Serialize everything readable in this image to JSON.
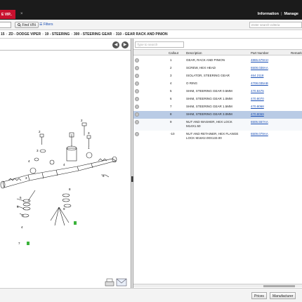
{
  "window": {
    "tab_label": "E VIP..",
    "close": "×"
  },
  "topnav": {
    "information": "Information",
    "sep": "|",
    "manage": "Manage"
  },
  "toolbar": {
    "find_vin": "Find VIN",
    "filters": "Filters",
    "search_placeholder": "Enter search criteria"
  },
  "breadcrumb": {
    "items": [
      "15",
      "ZD - DODGE VIPER",
      "19 - STEERING",
      "300 - STEERING GEAR",
      "310 - GEAR RACK AND PINION"
    ],
    "sep": "›"
  },
  "nav": {
    "prev": "◀",
    "next": "▶"
  },
  "filter": {
    "placeholder": "Type to search"
  },
  "table": {
    "headers": [
      "Callout",
      "Description",
      "Part Number",
      "Remark"
    ],
    "rows": [
      {
        "callout": "1",
        "description": [
          "GEAR, RACK AND PINION"
        ],
        "part_number": "4865.679AH"
      },
      {
        "callout": "2",
        "description": [
          "SCREW, HEX HEAD"
        ],
        "part_number": "6508.038AA"
      },
      {
        "callout": "3",
        "description": [
          "ISOLATOR, STEERING GEAR"
        ],
        "part_number": "464.2118"
      },
      {
        "callout": "4",
        "description": [
          "O RING"
        ],
        "part_number": "4708.035AB"
      },
      {
        "callout": "5",
        "description": [
          "SHIM, STEERING GEAR 0.5MM"
        ],
        "part_number": "470.8475"
      },
      {
        "callout": "6",
        "description": [
          "SHIM, STEERING GEAR 1.0MM"
        ],
        "part_number": "470.8070"
      },
      {
        "callout": "7",
        "description": [
          "SHIM, STEERING GEAR 1.5MM"
        ],
        "part_number": "470.8068"
      },
      {
        "callout": "8",
        "description": [
          "SHIM, STEERING GEAR 3.0MM"
        ],
        "part_number": "470.8069"
      },
      {
        "callout": "9",
        "description": [
          "NUT AND WASHER, HEX LOCK",
          "M14X1.50"
        ],
        "part_number": "6506.557AA"
      },
      {
        "callout": "-10",
        "description": [
          "NUT AND RETAINER, HEX FLANGE",
          "LOCK M16X2.00X133.00"
        ],
        "part_number": "6509.079AA"
      }
    ],
    "selected_index": 7
  },
  "bottom": {
    "prices": "Prices",
    "manufacturer": "Manufacturer"
  },
  "diagram": {
    "callouts": [
      "1",
      "2",
      "3",
      "4",
      "5",
      "6",
      "7",
      "8",
      "9",
      "4",
      "1",
      "3"
    ]
  }
}
